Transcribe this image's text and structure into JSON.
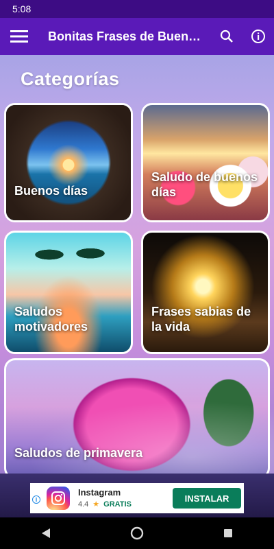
{
  "status_bar": {
    "time": "5:08"
  },
  "app_bar": {
    "title": "Bonitas Frases de Buen…",
    "menu_icon": "hamburger-menu-icon",
    "search_icon": "search-icon",
    "info_icon": "info-icon"
  },
  "section_title": "Categorías",
  "categories": [
    {
      "label": "Buenos días"
    },
    {
      "label": "Saludo de buenos días"
    },
    {
      "label": "Saludos motivadores"
    },
    {
      "label": "Frases sabias de la vida"
    },
    {
      "label": "Saludos de primavera"
    }
  ],
  "ad": {
    "app_name": "Instagram",
    "rating": "4.4",
    "star": "★",
    "price": "GRATIS",
    "install_label": "INSTALAR",
    "info_glyph": "i"
  },
  "colors": {
    "status_bar": "#3d0c84",
    "app_bar": "#5a1ab8",
    "install_button": "#0a7d5a"
  },
  "nav": {
    "back_icon": "back-triangle-icon",
    "home_icon": "home-circle-icon",
    "recents_icon": "recents-square-icon"
  }
}
